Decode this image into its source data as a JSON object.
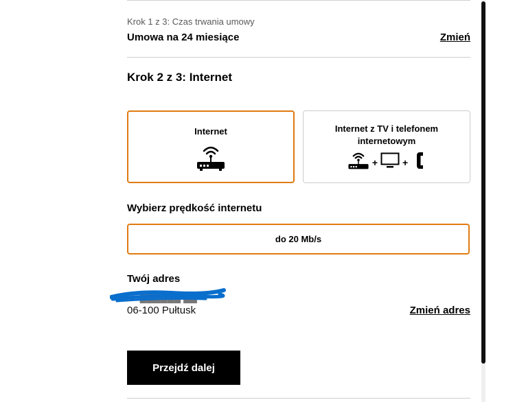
{
  "step1": {
    "label": "Krok 1 z 3: Czas trwania umowy",
    "value": "Umowa na 24 miesiące",
    "change_link": "Zmień"
  },
  "step2": {
    "title": "Krok 2 z 3: Internet",
    "options": [
      {
        "label": "Internet",
        "selected": true,
        "icons": [
          "router-icon"
        ]
      },
      {
        "label_line1": "Internet z TV i telefonem",
        "label_line2": "internetowym",
        "selected": false,
        "icons": [
          "router-icon",
          "tv-icon",
          "phone-icon"
        ],
        "separator": "+"
      }
    ]
  },
  "speed": {
    "label": "Wybierz prędkość internetu",
    "value": "do 20 Mb/s"
  },
  "address": {
    "title": "Twój adres",
    "line1_redacted": "ul. ██████ ██",
    "line2": "06-100 Pułtusk",
    "change_link": "Zmień adres"
  },
  "next_button": "Przejdź dalej",
  "colors": {
    "accent": "#e07a10",
    "primary": "#000000",
    "redaction": "#0a6ecc"
  }
}
